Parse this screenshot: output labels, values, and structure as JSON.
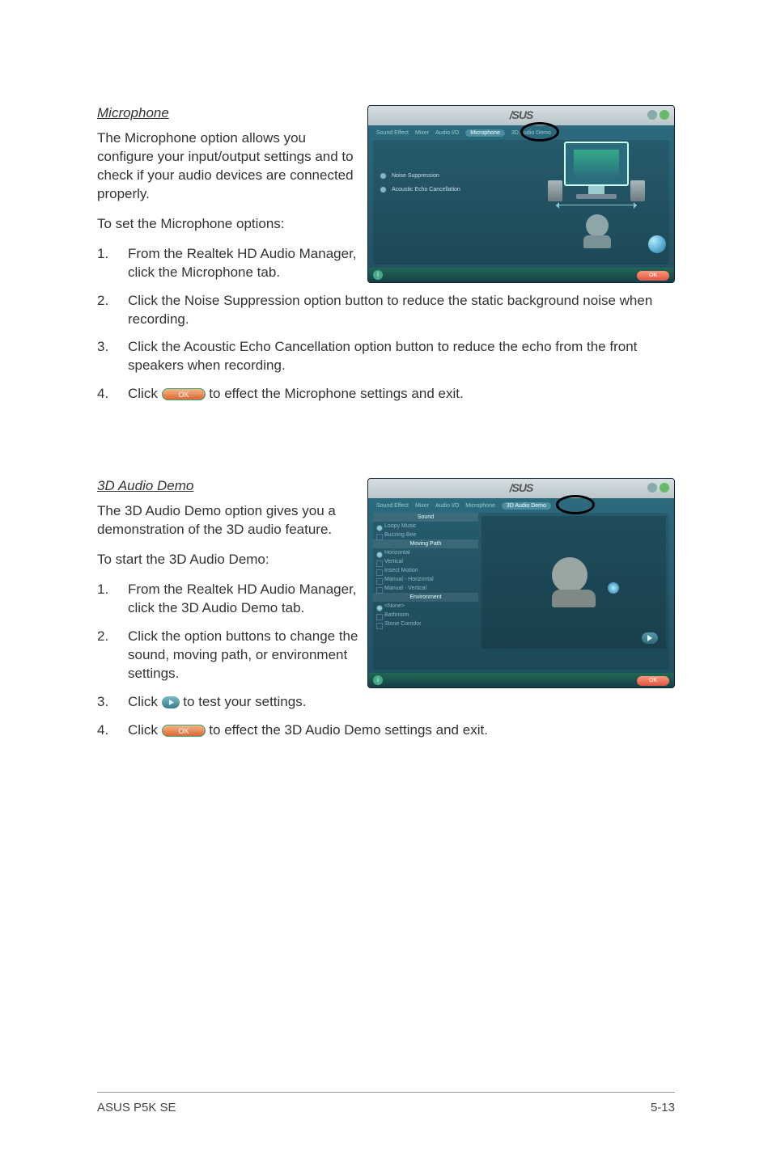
{
  "mic": {
    "heading": "Microphone",
    "intro": "The Microphone option allows you configure your input/output settings and to check if your audio devices are connected properly.",
    "toset": "To set the Microphone options:",
    "step1": "From the Realtek HD Audio Manager, click the Microphone tab.",
    "step2": "Click the Noise Suppression option button to reduce the static background noise when recording.",
    "step3": "Click the Acoustic Echo Cancellation option button to reduce the echo from the front speakers when recording.",
    "step4a": "Click ",
    "step4b": " to effect the Microphone settings and exit."
  },
  "demo": {
    "heading": "3D Audio Demo",
    "intro": "The 3D Audio Demo option gives you a demonstration of the 3D audio feature.",
    "tostart": "To start the 3D Audio Demo:",
    "step1": "From the Realtek HD Audio Manager, click the 3D Audio Demo tab.",
    "step2": "Click the option buttons to change the sound, moving path, or environment settings.",
    "step3a": "Click ",
    "step3b": " to test your settings.",
    "step4a": "Click ",
    "step4b": " to effect the 3D Audio Demo settings and exit."
  },
  "nums": {
    "n1": "1.",
    "n2": "2.",
    "n3": "3.",
    "n4": "4."
  },
  "shot": {
    "brand": "/SUS",
    "tabs": {
      "se": "Sound Effect",
      "mx": "Mixer",
      "aio": "Audio I/O",
      "mic": "Microphone",
      "demo": "3D Audio Demo"
    },
    "opt_ns": "Noise Suppression",
    "opt_aec": "Acoustic Echo Cancellation",
    "grp_sound": "Sound",
    "s_loopy": "Loopy Music",
    "s_buzz": "Buzzing Bee",
    "grp_path": "Moving Path",
    "p_h": "Horizontal",
    "p_v": "Vertical",
    "p_im": "Insect Motion",
    "p_mh": "Manual - Horizontal",
    "p_mv": "Manual - Vertical",
    "grp_env": "Environment",
    "e_none": "<None>",
    "e_bath": "Bathroom",
    "e_stone": "Stone Corridor",
    "ok": "OK",
    "info": "i"
  },
  "footer": {
    "left": "ASUS P5K SE",
    "right": "5-13"
  }
}
